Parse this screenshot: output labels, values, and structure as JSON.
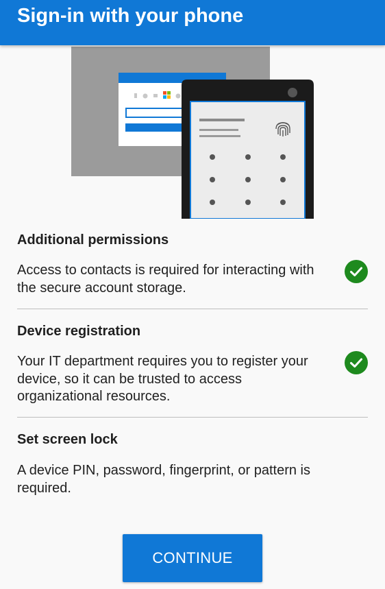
{
  "header": {
    "title": "Sign-in with your phone"
  },
  "illustration": {
    "icon": "phone-sign-in-illustration"
  },
  "sections": [
    {
      "title": "Additional permissions",
      "description": "Access to contacts is required for interacting with the secure account storage.",
      "status": "completed",
      "status_icon": "check-circle-icon"
    },
    {
      "title": "Device registration",
      "description": "Your IT department requires you to register your device, so it can be trusted to access organizational resources.",
      "status": "completed",
      "status_icon": "check-circle-icon"
    },
    {
      "title": "Set screen lock",
      "description": "A device PIN, password, fingerprint, or pattern is required.",
      "status": "pending"
    }
  ],
  "actions": {
    "continue_label": "CONTINUE"
  },
  "colors": {
    "accent": "#1078d6",
    "success": "#1e8a1e",
    "text": "#1f1f1f",
    "background": "#f9f9f9"
  }
}
